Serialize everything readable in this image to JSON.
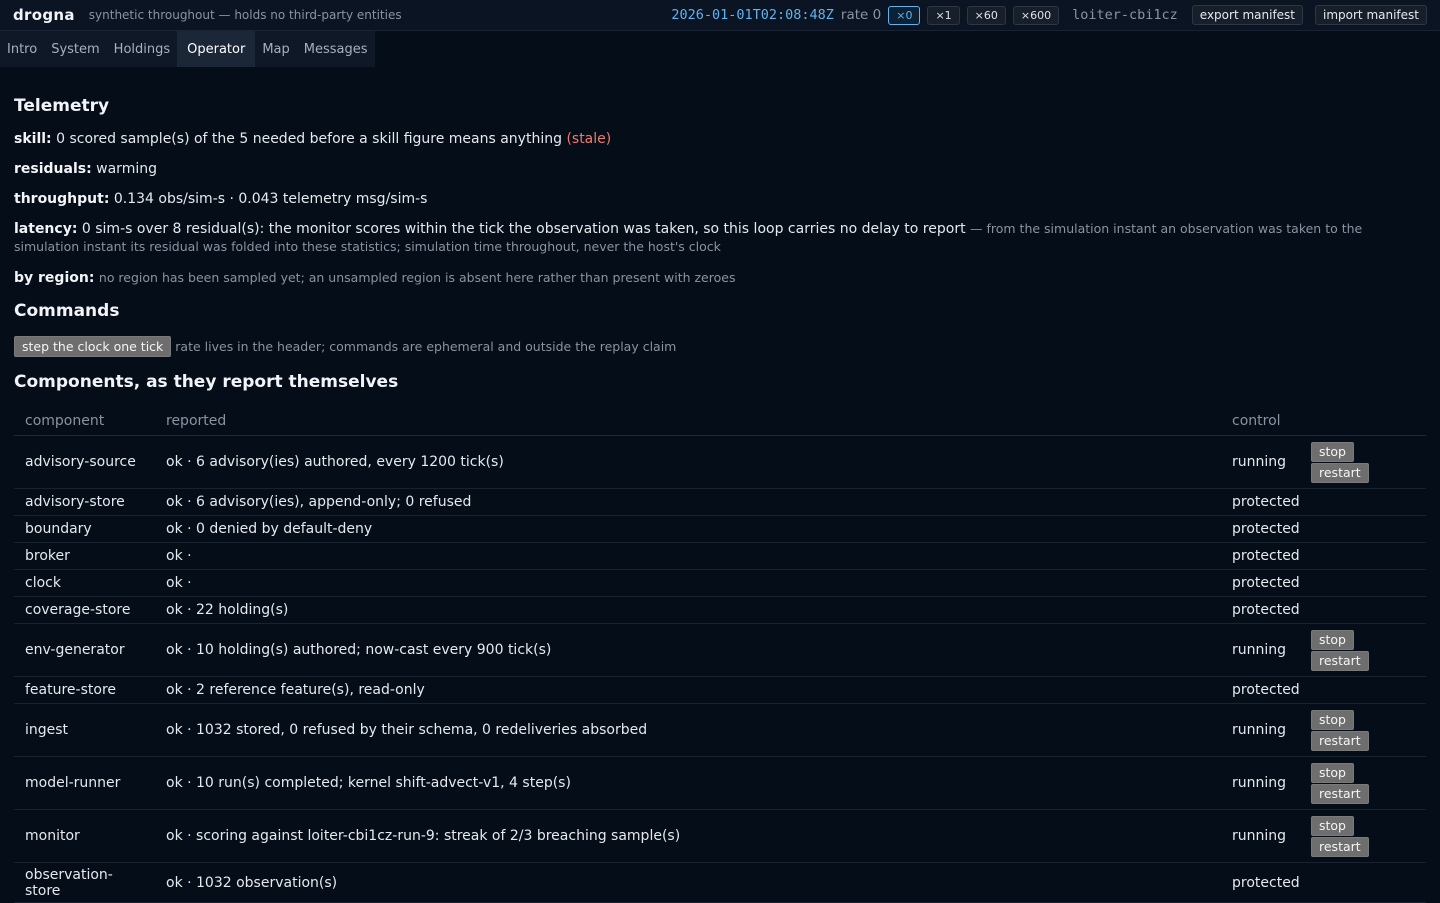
{
  "header": {
    "brand": "drogna",
    "tagline": "synthetic throughout — holds no third-party entities",
    "clock": "2026-01-01T02:08:48Z",
    "rate_label": "rate 0",
    "rates": [
      "×0",
      "×1",
      "×60",
      "×600"
    ],
    "run_id": "loiter-cbi1cz",
    "export_label": "export manifest",
    "import_label": "import manifest"
  },
  "tabs": [
    "Intro",
    "System",
    "Holdings",
    "Operator",
    "Map",
    "Messages"
  ],
  "telemetry": {
    "title": "Telemetry",
    "skill_label": "skill:",
    "skill_text": "0 scored sample(s) of the 5 needed before a skill figure means anything",
    "skill_stale": "(stale)",
    "residuals_label": "residuals:",
    "residuals_text": "warming",
    "throughput_label": "throughput:",
    "throughput_text": "0.134 obs/sim-s · 0.043 telemetry msg/sim-s",
    "latency_label": "latency:",
    "latency_text": "0 sim-s over 8 residual(s): the monitor scores within the tick the observation was taken, so this loop carries no delay to report",
    "latency_note": "— from the simulation instant an observation was taken to the simulation instant its residual was folded into these statistics; simulation time throughout, never the host's clock",
    "region_label": "by region:",
    "region_text": "no region has been sampled yet; an unsampled region is absent here rather than present with zeroes"
  },
  "commands": {
    "title": "Commands",
    "step_label": "step the clock one tick",
    "note": "rate lives in the header; commands are ephemeral and outside the replay claim"
  },
  "components": {
    "title": "Components, as they report themselves",
    "columns": [
      "component",
      "reported",
      "control"
    ],
    "stop_label": "stop",
    "restart_label": "restart",
    "rows": [
      {
        "name": "advisory-source",
        "reported": "ok · 6 advisory(ies) authored, every 1200 tick(s)",
        "control": "running"
      },
      {
        "name": "advisory-store",
        "reported": "ok · 6 advisory(ies), append-only; 0 refused",
        "control": "protected"
      },
      {
        "name": "boundary",
        "reported": "ok · 0 denied by default-deny",
        "control": "protected"
      },
      {
        "name": "broker",
        "reported": "ok ·",
        "control": "protected"
      },
      {
        "name": "clock",
        "reported": "ok ·",
        "control": "protected"
      },
      {
        "name": "coverage-store",
        "reported": "ok · 22 holding(s)",
        "control": "protected"
      },
      {
        "name": "env-generator",
        "reported": "ok · 10 holding(s) authored; now-cast every 900 tick(s)",
        "control": "running"
      },
      {
        "name": "feature-store",
        "reported": "ok · 2 reference feature(s), read-only",
        "control": "protected"
      },
      {
        "name": "ingest",
        "reported": "ok · 1032 stored, 0 refused by their schema, 0 redeliveries absorbed",
        "control": "running"
      },
      {
        "name": "model-runner",
        "reported": "ok · 10 run(s) completed; kernel shift-advect-v1, 4 step(s)",
        "control": "running"
      },
      {
        "name": "monitor",
        "reported": "ok · scoring against loiter-cbi1cz-run-9: streak of 2/3 breaching sample(s)",
        "control": "running"
      },
      {
        "name": "observation-store",
        "reported": "ok · 1032 observation(s)",
        "control": "protected"
      }
    ]
  }
}
